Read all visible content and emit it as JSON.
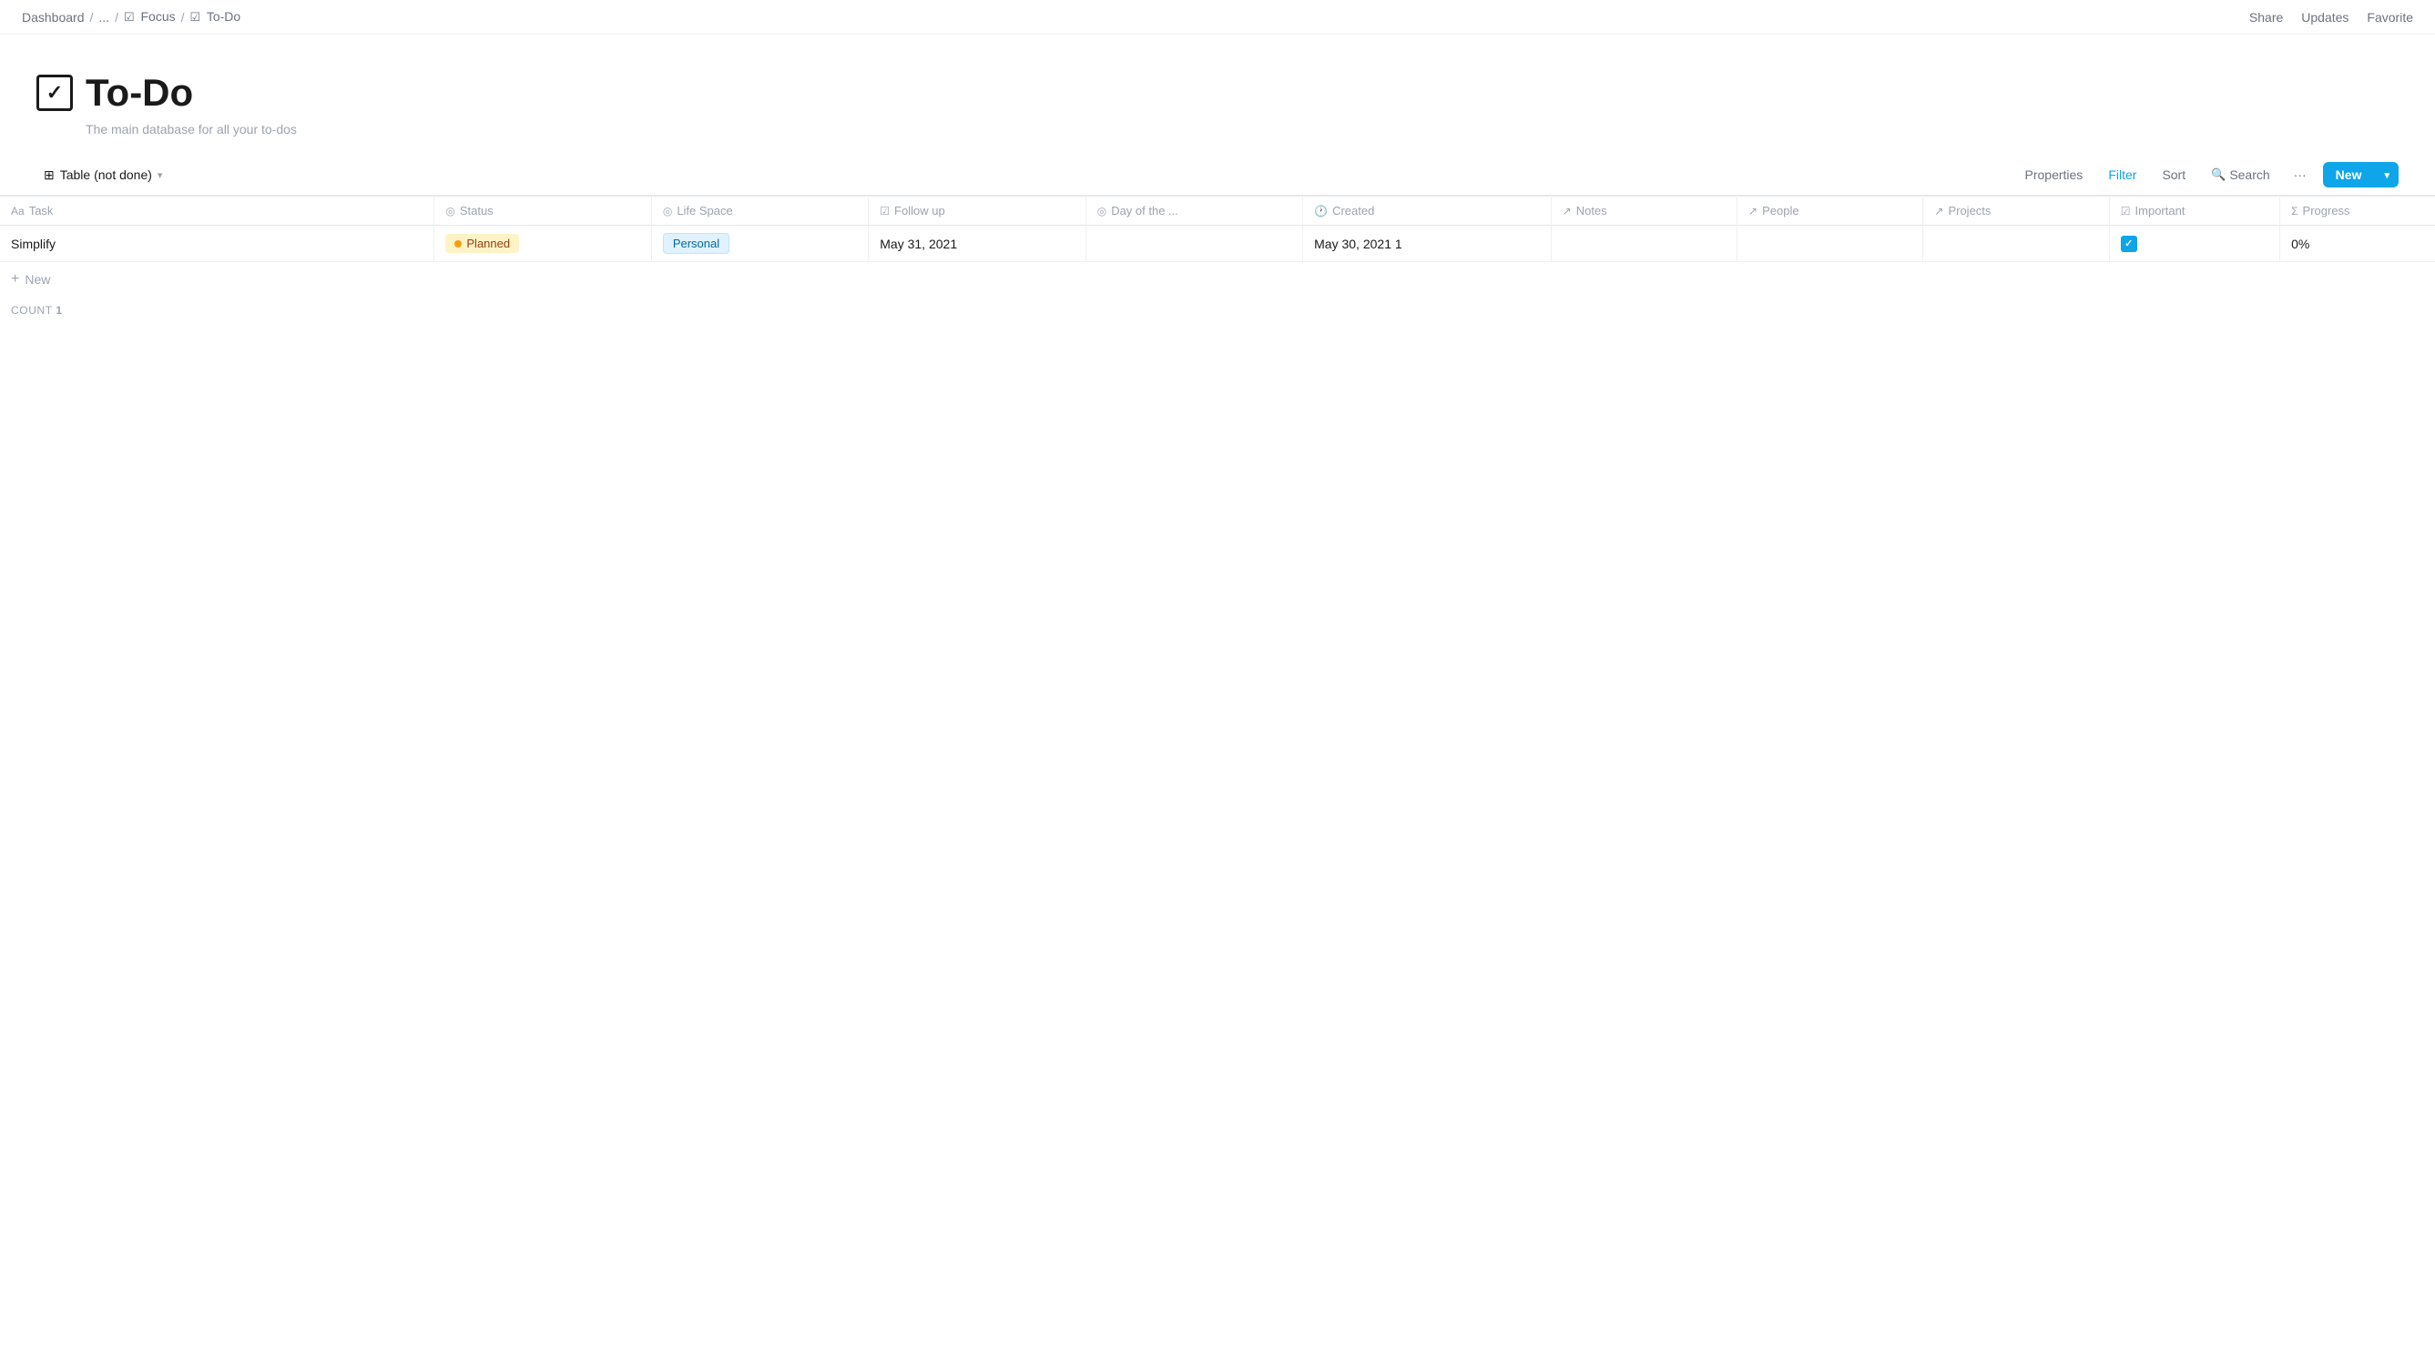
{
  "breadcrumb": {
    "items": [
      "Dashboard",
      "...",
      "Focus",
      "To-Do"
    ],
    "separators": [
      "/",
      "/",
      "/"
    ]
  },
  "header_actions": {
    "share": "Share",
    "updates": "Updates",
    "favorite": "Favorite"
  },
  "page": {
    "title": "To-Do",
    "subtitle": "The main database for all your to-dos",
    "icon_symbol": "✓"
  },
  "toolbar": {
    "view_label": "Table (not done)",
    "properties": "Properties",
    "filter": "Filter",
    "sort": "Sort",
    "search": "Search",
    "more": "···",
    "new_button": "New"
  },
  "columns": {
    "task": {
      "label": "Task",
      "icon": "Aa"
    },
    "status": {
      "label": "Status",
      "icon": "◎"
    },
    "life_space": {
      "label": "Life Space",
      "icon": "◎"
    },
    "follow_up": {
      "label": "Follow up",
      "icon": "☑"
    },
    "day_of_the": {
      "label": "Day of the ...",
      "icon": "◎"
    },
    "created": {
      "label": "Created",
      "icon": "🕐"
    },
    "notes": {
      "label": "Notes",
      "icon": "↗"
    },
    "people": {
      "label": "People",
      "icon": "↗"
    },
    "projects": {
      "label": "Projects",
      "icon": "↗"
    },
    "important": {
      "label": "Important",
      "icon": "☑"
    },
    "progress": {
      "label": "Progress",
      "icon": "Σ"
    }
  },
  "rows": [
    {
      "task": "Simplify",
      "status": "Planned",
      "life_space": "Personal",
      "follow_up": "May 31, 2021",
      "day_of_the": "",
      "created": "May 30, 2021 1",
      "notes": "",
      "people": "",
      "projects": "",
      "important": true,
      "progress": "0%"
    }
  ],
  "add_row_label": "New",
  "count_label": "COUNT",
  "count_value": "1"
}
